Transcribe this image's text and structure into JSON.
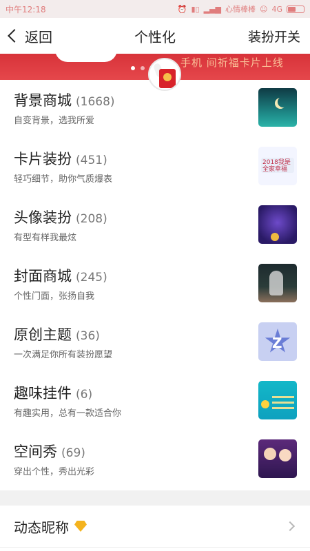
{
  "status_bar": {
    "time": "中午12:18",
    "network": "4G",
    "carrier_note": "心情棒棒",
    "battery_level": 0.55,
    "icons": [
      "alarm-icon",
      "vibrate-icon",
      "signal-icon",
      "emoji-icon"
    ]
  },
  "nav": {
    "back_label": "返回",
    "title": "个性化",
    "right_label": "装扮开关"
  },
  "banner": {
    "text": "手机  间祈福卡片上线",
    "dot_count": 4,
    "active_dot": 0
  },
  "items": [
    {
      "title": "背景商城",
      "count": "(1668)",
      "desc": "自变背景，选我所爱",
      "thumb": "background"
    },
    {
      "title": "卡片装扮",
      "count": "(451)",
      "desc": "轻巧细节，助你气质爆表",
      "thumb": "card"
    },
    {
      "title": "头像装扮",
      "count": "(208)",
      "desc": "有型有样我最炫",
      "thumb": "avatar"
    },
    {
      "title": "封面商城",
      "count": "(245)",
      "desc": "个性门面，张扬自我",
      "thumb": "cover"
    },
    {
      "title": "原创主题",
      "count": "(36)",
      "desc": "一次满足你所有装扮愿望",
      "thumb": "theme"
    },
    {
      "title": "趣味挂件",
      "count": "(6)",
      "desc": "有趣实用，总有一款适合你",
      "thumb": "widget"
    },
    {
      "title": "空间秀",
      "count": "(69)",
      "desc": "穿出个性，秀出光彩",
      "thumb": "space"
    }
  ],
  "card_thumb_text": "2018我是\n全家幸福",
  "nickname_row": {
    "label": "动态昵称"
  },
  "colors": {
    "banner_red": "#d8333a",
    "status_text": "#e07d7d",
    "diamond": "#f4b31e"
  }
}
